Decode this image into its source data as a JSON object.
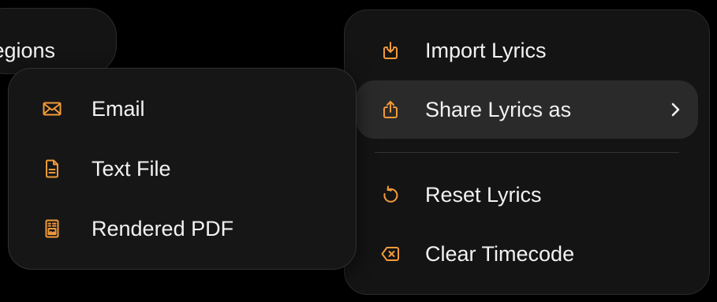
{
  "background_pill": {
    "label": "Regions"
  },
  "main_menu": {
    "items": [
      {
        "label": "Import Lyrics",
        "icon": "import-icon"
      },
      {
        "label": "Share Lyrics as",
        "icon": "share-icon",
        "has_submenu": true,
        "highlighted": true
      },
      {
        "label": "Reset Lyrics",
        "icon": "reset-icon"
      },
      {
        "label": "Clear Timecode",
        "icon": "clear-icon"
      }
    ]
  },
  "share_submenu": {
    "items": [
      {
        "label": "Email",
        "icon": "envelope-icon"
      },
      {
        "label": "Text File",
        "icon": "document-icon"
      },
      {
        "label": "Rendered PDF",
        "icon": "pdf-document-icon"
      }
    ]
  },
  "colors": {
    "accent": "#f29a3a",
    "background": "#000000",
    "menu_surface": "#141414",
    "highlight": "#2a2a2a",
    "text": "#f2f2f2"
  }
}
